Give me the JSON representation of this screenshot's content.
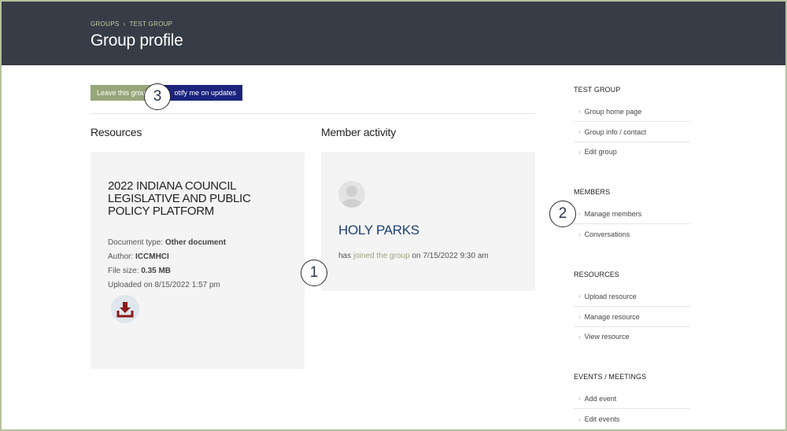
{
  "header": {
    "breadcrumb": [
      "GROUPS",
      "TEST GROUP"
    ],
    "breadcrumb_sep": "›",
    "title": "Group profile"
  },
  "actions": {
    "leave_label": "Leave this grou",
    "notify_label": "otify me on updates"
  },
  "callouts": [
    "1",
    "2",
    "3"
  ],
  "resources": {
    "heading": "Resources",
    "card": {
      "title": "2022 INDIANA COUNCIL LEGISLATIVE AND PUBLIC POLICY PLATFORM",
      "doc_type_label": "Document type:",
      "doc_type": "Other document",
      "author_label": "Author:",
      "author": "ICCMHCI",
      "size_label": "File size:",
      "size": "0.35 MB",
      "uploaded": "Uploaded on 8/15/2022 1:57 pm"
    }
  },
  "activity": {
    "heading": "Member activity",
    "member_name": "HOLY PARKS",
    "prefix": "has",
    "link": "joined the group",
    "suffix": "on 7/15/2022 9:30 am"
  },
  "sidebar": {
    "groups": [
      {
        "heading": "TEST GROUP",
        "items": [
          "Group home page",
          "Group info / contact",
          "Edit group"
        ]
      },
      {
        "heading": "MEMBERS",
        "items": [
          "Manage members",
          "Conversations"
        ]
      },
      {
        "heading": "RESOURCES",
        "items": [
          "Upload resource",
          "Manage resource",
          "View resource"
        ]
      },
      {
        "heading": "EVENTS / MEETINGS",
        "items": [
          "Add event",
          "Edit events"
        ]
      }
    ]
  },
  "colors": {
    "header_bg": "#363d46",
    "accent_green": "#96a77a",
    "notify_blue": "#1b237d",
    "name_blue": "#1f3f73",
    "download_red": "#8b1a1a"
  }
}
